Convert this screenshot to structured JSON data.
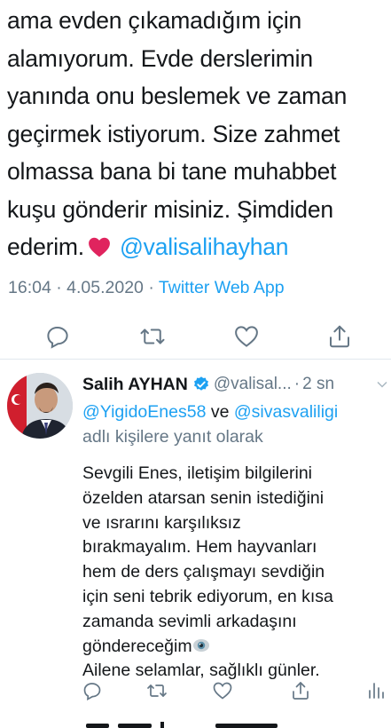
{
  "tweet": {
    "text_lines": [
      "ama evden çıkamadığım için",
      "alamıyorum. Evde derslerimin",
      "yanında onu beslemek ve zaman",
      "geçirmek istiyorum. Size zahmet",
      "olmassa bana bi tane muhabbet",
      "kuşu gönderir misiniz. Şimdiden",
      "ederim."
    ],
    "mention": "@valisalihayhan",
    "time": "16:04",
    "date": "4.05.2020",
    "source": "Twitter Web App",
    "separator": "·"
  },
  "actions": {
    "icons": [
      "reply-icon",
      "retweet-icon",
      "like-icon",
      "share-icon"
    ]
  },
  "reply": {
    "name": "Salih AYHAN",
    "handle": "@valisal...",
    "separator": "·",
    "time": "2 sn",
    "replying_to_1": "@YigidoEnes58",
    "replying_and": "ve",
    "replying_to_2": "@sivasvaliligi",
    "replying_suffix": "adlı kişilere yanıt olarak",
    "text_lines": [
      "Sevgili Enes, iletişim bilgilerini",
      "özelden atarsan senin istediğini",
      "ve ısrarını karşılıksız",
      "bırakmayalım. Hem hayvanları",
      "hem de ders çalışmayı sevdiğin",
      "için seni tebrik ediyorum, en kısa",
      "zamanda sevimli arkadaşını",
      "göndereceğim",
      "Ailene selamlar, sağlıklı günler."
    ]
  },
  "colors": {
    "link": "#1da1f2",
    "secondary": "#657786",
    "text": "#14171a",
    "heart": "#e0245e"
  }
}
